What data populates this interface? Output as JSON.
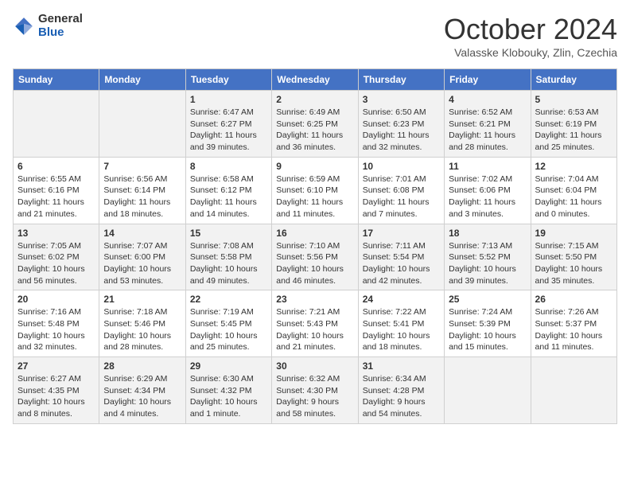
{
  "header": {
    "logo_general": "General",
    "logo_blue": "Blue",
    "month_title": "October 2024",
    "location": "Valasske Klobouky, Zlin, Czechia"
  },
  "days_of_week": [
    "Sunday",
    "Monday",
    "Tuesday",
    "Wednesday",
    "Thursday",
    "Friday",
    "Saturday"
  ],
  "weeks": [
    [
      {
        "day": "",
        "info": ""
      },
      {
        "day": "",
        "info": ""
      },
      {
        "day": "1",
        "info": "Sunrise: 6:47 AM\nSunset: 6:27 PM\nDaylight: 11 hours and 39 minutes."
      },
      {
        "day": "2",
        "info": "Sunrise: 6:49 AM\nSunset: 6:25 PM\nDaylight: 11 hours and 36 minutes."
      },
      {
        "day": "3",
        "info": "Sunrise: 6:50 AM\nSunset: 6:23 PM\nDaylight: 11 hours and 32 minutes."
      },
      {
        "day": "4",
        "info": "Sunrise: 6:52 AM\nSunset: 6:21 PM\nDaylight: 11 hours and 28 minutes."
      },
      {
        "day": "5",
        "info": "Sunrise: 6:53 AM\nSunset: 6:19 PM\nDaylight: 11 hours and 25 minutes."
      }
    ],
    [
      {
        "day": "6",
        "info": "Sunrise: 6:55 AM\nSunset: 6:16 PM\nDaylight: 11 hours and 21 minutes."
      },
      {
        "day": "7",
        "info": "Sunrise: 6:56 AM\nSunset: 6:14 PM\nDaylight: 11 hours and 18 minutes."
      },
      {
        "day": "8",
        "info": "Sunrise: 6:58 AM\nSunset: 6:12 PM\nDaylight: 11 hours and 14 minutes."
      },
      {
        "day": "9",
        "info": "Sunrise: 6:59 AM\nSunset: 6:10 PM\nDaylight: 11 hours and 11 minutes."
      },
      {
        "day": "10",
        "info": "Sunrise: 7:01 AM\nSunset: 6:08 PM\nDaylight: 11 hours and 7 minutes."
      },
      {
        "day": "11",
        "info": "Sunrise: 7:02 AM\nSunset: 6:06 PM\nDaylight: 11 hours and 3 minutes."
      },
      {
        "day": "12",
        "info": "Sunrise: 7:04 AM\nSunset: 6:04 PM\nDaylight: 11 hours and 0 minutes."
      }
    ],
    [
      {
        "day": "13",
        "info": "Sunrise: 7:05 AM\nSunset: 6:02 PM\nDaylight: 10 hours and 56 minutes."
      },
      {
        "day": "14",
        "info": "Sunrise: 7:07 AM\nSunset: 6:00 PM\nDaylight: 10 hours and 53 minutes."
      },
      {
        "day": "15",
        "info": "Sunrise: 7:08 AM\nSunset: 5:58 PM\nDaylight: 10 hours and 49 minutes."
      },
      {
        "day": "16",
        "info": "Sunrise: 7:10 AM\nSunset: 5:56 PM\nDaylight: 10 hours and 46 minutes."
      },
      {
        "day": "17",
        "info": "Sunrise: 7:11 AM\nSunset: 5:54 PM\nDaylight: 10 hours and 42 minutes."
      },
      {
        "day": "18",
        "info": "Sunrise: 7:13 AM\nSunset: 5:52 PM\nDaylight: 10 hours and 39 minutes."
      },
      {
        "day": "19",
        "info": "Sunrise: 7:15 AM\nSunset: 5:50 PM\nDaylight: 10 hours and 35 minutes."
      }
    ],
    [
      {
        "day": "20",
        "info": "Sunrise: 7:16 AM\nSunset: 5:48 PM\nDaylight: 10 hours and 32 minutes."
      },
      {
        "day": "21",
        "info": "Sunrise: 7:18 AM\nSunset: 5:46 PM\nDaylight: 10 hours and 28 minutes."
      },
      {
        "day": "22",
        "info": "Sunrise: 7:19 AM\nSunset: 5:45 PM\nDaylight: 10 hours and 25 minutes."
      },
      {
        "day": "23",
        "info": "Sunrise: 7:21 AM\nSunset: 5:43 PM\nDaylight: 10 hours and 21 minutes."
      },
      {
        "day": "24",
        "info": "Sunrise: 7:22 AM\nSunset: 5:41 PM\nDaylight: 10 hours and 18 minutes."
      },
      {
        "day": "25",
        "info": "Sunrise: 7:24 AM\nSunset: 5:39 PM\nDaylight: 10 hours and 15 minutes."
      },
      {
        "day": "26",
        "info": "Sunrise: 7:26 AM\nSunset: 5:37 PM\nDaylight: 10 hours and 11 minutes."
      }
    ],
    [
      {
        "day": "27",
        "info": "Sunrise: 6:27 AM\nSunset: 4:35 PM\nDaylight: 10 hours and 8 minutes."
      },
      {
        "day": "28",
        "info": "Sunrise: 6:29 AM\nSunset: 4:34 PM\nDaylight: 10 hours and 4 minutes."
      },
      {
        "day": "29",
        "info": "Sunrise: 6:30 AM\nSunset: 4:32 PM\nDaylight: 10 hours and 1 minute."
      },
      {
        "day": "30",
        "info": "Sunrise: 6:32 AM\nSunset: 4:30 PM\nDaylight: 9 hours and 58 minutes."
      },
      {
        "day": "31",
        "info": "Sunrise: 6:34 AM\nSunset: 4:28 PM\nDaylight: 9 hours and 54 minutes."
      },
      {
        "day": "",
        "info": ""
      },
      {
        "day": "",
        "info": ""
      }
    ]
  ]
}
